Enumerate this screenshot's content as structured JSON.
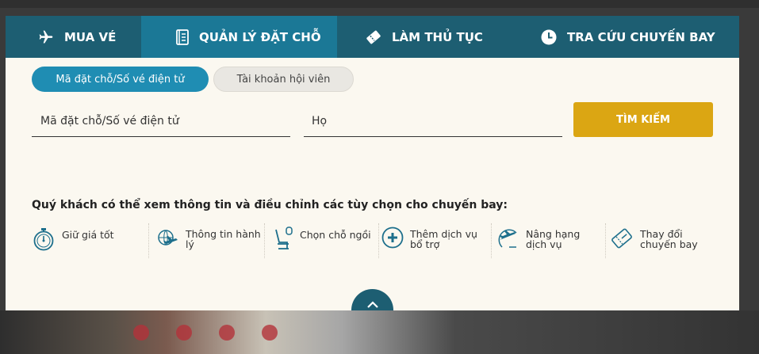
{
  "tabs": [
    {
      "label": "MUA VÉ",
      "icon": "airplane-icon"
    },
    {
      "label": "QUẢN LÝ ĐẶT CHỖ",
      "icon": "booking-book-icon"
    },
    {
      "label": "LÀM THỦ TỤC",
      "icon": "ticket-icon"
    },
    {
      "label": "TRA CỨU CHUYẾN BAY",
      "icon": "clock-icon"
    }
  ],
  "active_tab": "QUẢN LÝ ĐẶT CHỖ",
  "toggle": {
    "booking_code_label": "Mã đặt chỗ/Số vé điện tử",
    "member_account_label": "Tài khoản hội viên"
  },
  "form": {
    "booking_code_placeholder": "Mã đặt chỗ/Số vé điện tử",
    "last_name_placeholder": "Họ",
    "search_label": "TÌM KIẾM"
  },
  "info_heading": "Quý khách có thể xem thông tin và điều chỉnh các tùy chọn cho chuyến bay:",
  "options": [
    {
      "label": "Giữ giá tốt",
      "icon": "stopwatch-icon"
    },
    {
      "label": "Thông tin hành lý",
      "icon": "baggage-globe-icon"
    },
    {
      "label": "Chọn chỗ ngồi",
      "icon": "seat-icon"
    },
    {
      "label": "Thêm dịch vụ bổ trợ",
      "icon": "plus-circle-icon"
    },
    {
      "label": "Nâng hạng dịch vụ",
      "icon": "upgrade-plane-icon"
    },
    {
      "label": "Thay đổi chuyến bay",
      "icon": "change-ticket-icon"
    }
  ],
  "colors": {
    "tab_bar": "#1d5e72",
    "tab_active": "#1b7896",
    "pill_active": "#1f8db3",
    "search_button": "#dba613",
    "panel_bg": "#fbf8f0",
    "icon_color": "#1d6f8c"
  }
}
